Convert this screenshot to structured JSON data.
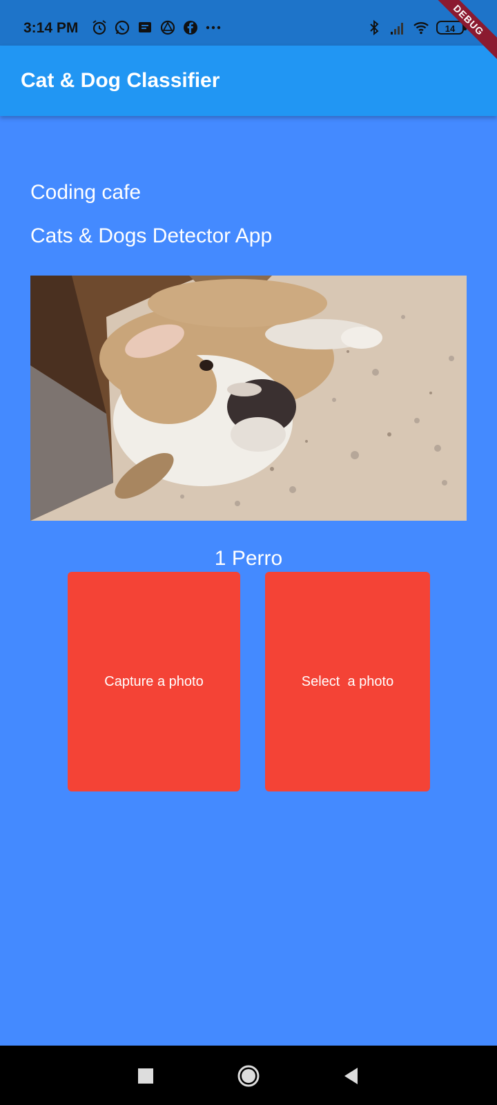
{
  "status_bar": {
    "time": "3:14 PM",
    "left_icons": [
      "alarm-icon",
      "whatsapp-icon",
      "message-icon",
      "vpn-icon",
      "facebook-icon",
      "more-icon"
    ],
    "right_icons": [
      "bluetooth-icon",
      "signal-icon",
      "wifi-icon",
      "battery-icon"
    ],
    "battery": "14"
  },
  "debug_banner": "DEBUG",
  "app_bar": {
    "title": "Cat & Dog Classifier"
  },
  "main": {
    "line1": "Coding cafe",
    "line2": "Cats & Dogs Detector App",
    "image_alt": "bulldog-photo",
    "result": "1 Perro",
    "buttons": {
      "capture": "Capture a photo",
      "select": "Select  a photo"
    }
  },
  "nav_bar": {
    "icons": [
      "recents-icon",
      "home-icon",
      "back-icon"
    ]
  },
  "colors": {
    "background": "#448AFF",
    "app_bar": "#2196F3",
    "status_bar": "#1E74C9",
    "button": "#F44336"
  }
}
